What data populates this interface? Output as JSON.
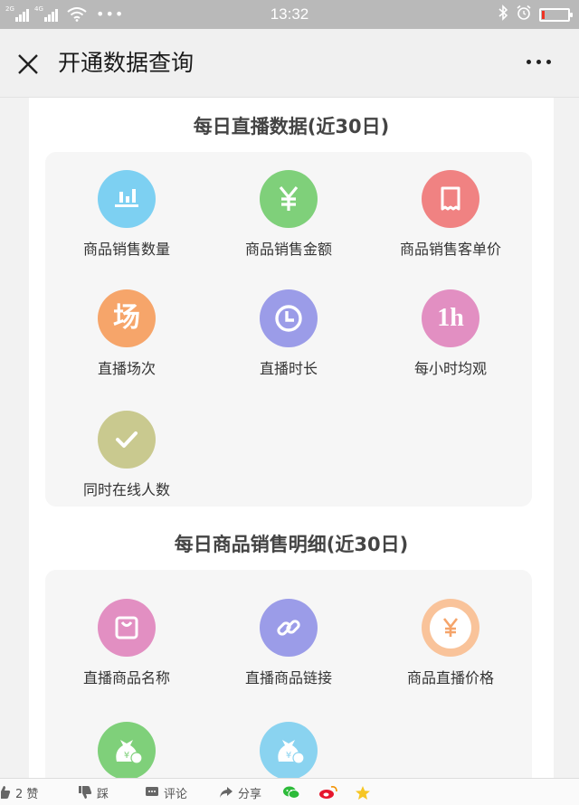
{
  "status_bar": {
    "net1": "2G",
    "net2": "4G",
    "time": "13:32"
  },
  "header": {
    "title": "开通数据查询"
  },
  "sections": [
    {
      "title": "每日直播数据(近30日)",
      "items": [
        {
          "label": "商品销售数量",
          "icon": "bar-chart-icon",
          "color": "#7dd0f2"
        },
        {
          "label": "商品销售金额",
          "icon": "yen-icon",
          "color": "#7fd07a"
        },
        {
          "label": "商品销售客单价",
          "icon": "receipt-icon",
          "color": "#f08282"
        },
        {
          "label": "直播场次",
          "icon": "field-char-icon",
          "glyph": "场",
          "color": "#f6a56a"
        },
        {
          "label": "直播时长",
          "icon": "clock-icon",
          "color": "#9b9ce8"
        },
        {
          "label": "每小时均观",
          "icon": "one-hour-icon",
          "glyph": "1h",
          "color": "#e28fc2"
        },
        {
          "label": "同时在线人数",
          "icon": "checkmark-icon",
          "color": "#c9c98f"
        }
      ]
    },
    {
      "title": "每日商品销售明细(近30日)",
      "items": [
        {
          "label": "直播商品名称",
          "icon": "shopping-bag-icon",
          "color": "#e28fc2"
        },
        {
          "label": "直播商品链接",
          "icon": "link-icon",
          "color": "#9b9ce8"
        },
        {
          "label": "商品直播价格",
          "icon": "yen-coin-icon",
          "color": "#f9c39a"
        },
        {
          "label": "",
          "icon": "money-bag-icon",
          "color": "#7fd07a"
        },
        {
          "label": "",
          "icon": "money-bag-icon",
          "color": "#8ad3f0"
        }
      ]
    }
  ],
  "bottom_bar": {
    "like": "2 赞",
    "dislike": "踩",
    "comment": "评论",
    "share": "分享"
  }
}
